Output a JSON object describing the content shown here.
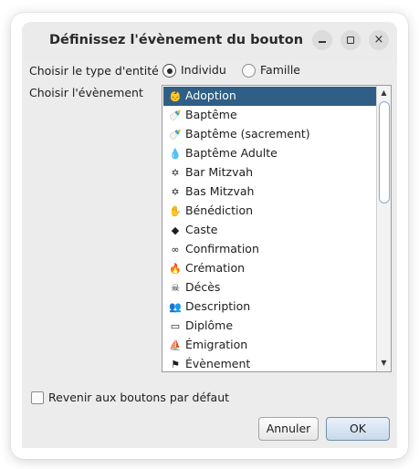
{
  "window": {
    "title": "Définissez l'évènement du bouton",
    "controls": {
      "minimize": "–",
      "maximize": "□",
      "close": "×"
    }
  },
  "entity_type": {
    "label": "Choisir le type d'entité",
    "options": [
      {
        "label": "Individu",
        "selected": true
      },
      {
        "label": "Famille",
        "selected": false
      }
    ]
  },
  "event": {
    "label": "Choisir l'évènement",
    "items": [
      {
        "label": "Adoption",
        "icon": "adoption-icon",
        "glyph": "👶",
        "selected": true
      },
      {
        "label": "Baptême",
        "icon": "baptism-icon",
        "glyph": "🍼",
        "selected": false
      },
      {
        "label": "Baptême (sacrement)",
        "icon": "baptism-sacrament-icon",
        "glyph": "🍼",
        "selected": false
      },
      {
        "label": "Baptême Adulte",
        "icon": "adult-baptism-icon",
        "glyph": "💧",
        "selected": false
      },
      {
        "label": "Bar Mitzvah",
        "icon": "star-of-david-icon",
        "glyph": "✡",
        "selected": false
      },
      {
        "label": "Bas Mitzvah",
        "icon": "star-of-david-icon",
        "glyph": "✡",
        "selected": false
      },
      {
        "label": "Bénédiction",
        "icon": "blessing-hand-icon",
        "glyph": "✋",
        "selected": false
      },
      {
        "label": "Caste",
        "icon": "diamond-icon",
        "glyph": "◆",
        "selected": false
      },
      {
        "label": "Confirmation",
        "icon": "confirmation-icon",
        "glyph": "∞",
        "selected": false
      },
      {
        "label": "Crémation",
        "icon": "flame-icon",
        "glyph": "🔥",
        "selected": false
      },
      {
        "label": "Décès",
        "icon": "skull-icon",
        "glyph": "☠",
        "selected": false
      },
      {
        "label": "Description",
        "icon": "people-icon",
        "glyph": "👥",
        "selected": false
      },
      {
        "label": "Diplôme",
        "icon": "diploma-icon",
        "glyph": "▭",
        "selected": false
      },
      {
        "label": "Émigration",
        "icon": "ship-icon",
        "glyph": "⛵",
        "selected": false
      },
      {
        "label": "Évènement",
        "icon": "event-icon",
        "glyph": "⚑",
        "selected": false
      }
    ]
  },
  "reset_checkbox": {
    "label": "Revenir aux boutons par défaut",
    "checked": false
  },
  "buttons": {
    "cancel": "Annuler",
    "ok": "OK"
  },
  "colors": {
    "selection": "#2f5f86",
    "dialog_bg": "#ececec"
  }
}
